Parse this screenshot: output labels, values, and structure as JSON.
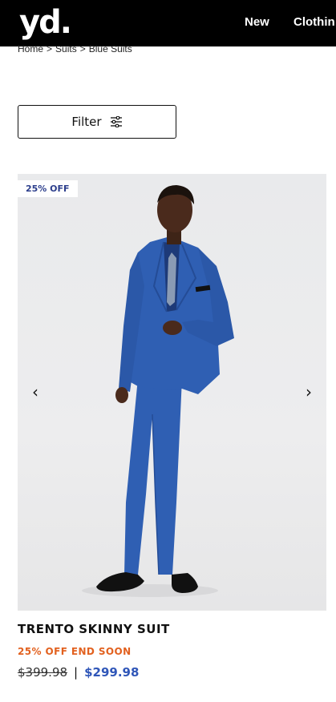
{
  "header": {
    "logo": "yd.",
    "nav": [
      "New",
      "Clothin"
    ]
  },
  "breadcrumb": {
    "items": [
      "Home",
      "Suits",
      "Blue Suits"
    ],
    "separator": ">"
  },
  "filter": {
    "label": "Filter",
    "icon": "sliders-icon"
  },
  "product": {
    "badge": "25% OFF",
    "name": "TRENTO SKINNY SUIT",
    "promo": "25% OFF END SOON",
    "old_price": "$399.98",
    "price_divider": "|",
    "new_price": "$299.98",
    "prev_icon": "chevron-left-icon",
    "next_icon": "chevron-right-icon",
    "prev_glyph": "‹",
    "next_glyph": "›"
  },
  "colors": {
    "accent": "#2f56b8",
    "promo": "#e2611f",
    "badge_text": "#2c3e8c",
    "suit_blue": "#2f5fb3",
    "header_bg": "#000000"
  }
}
